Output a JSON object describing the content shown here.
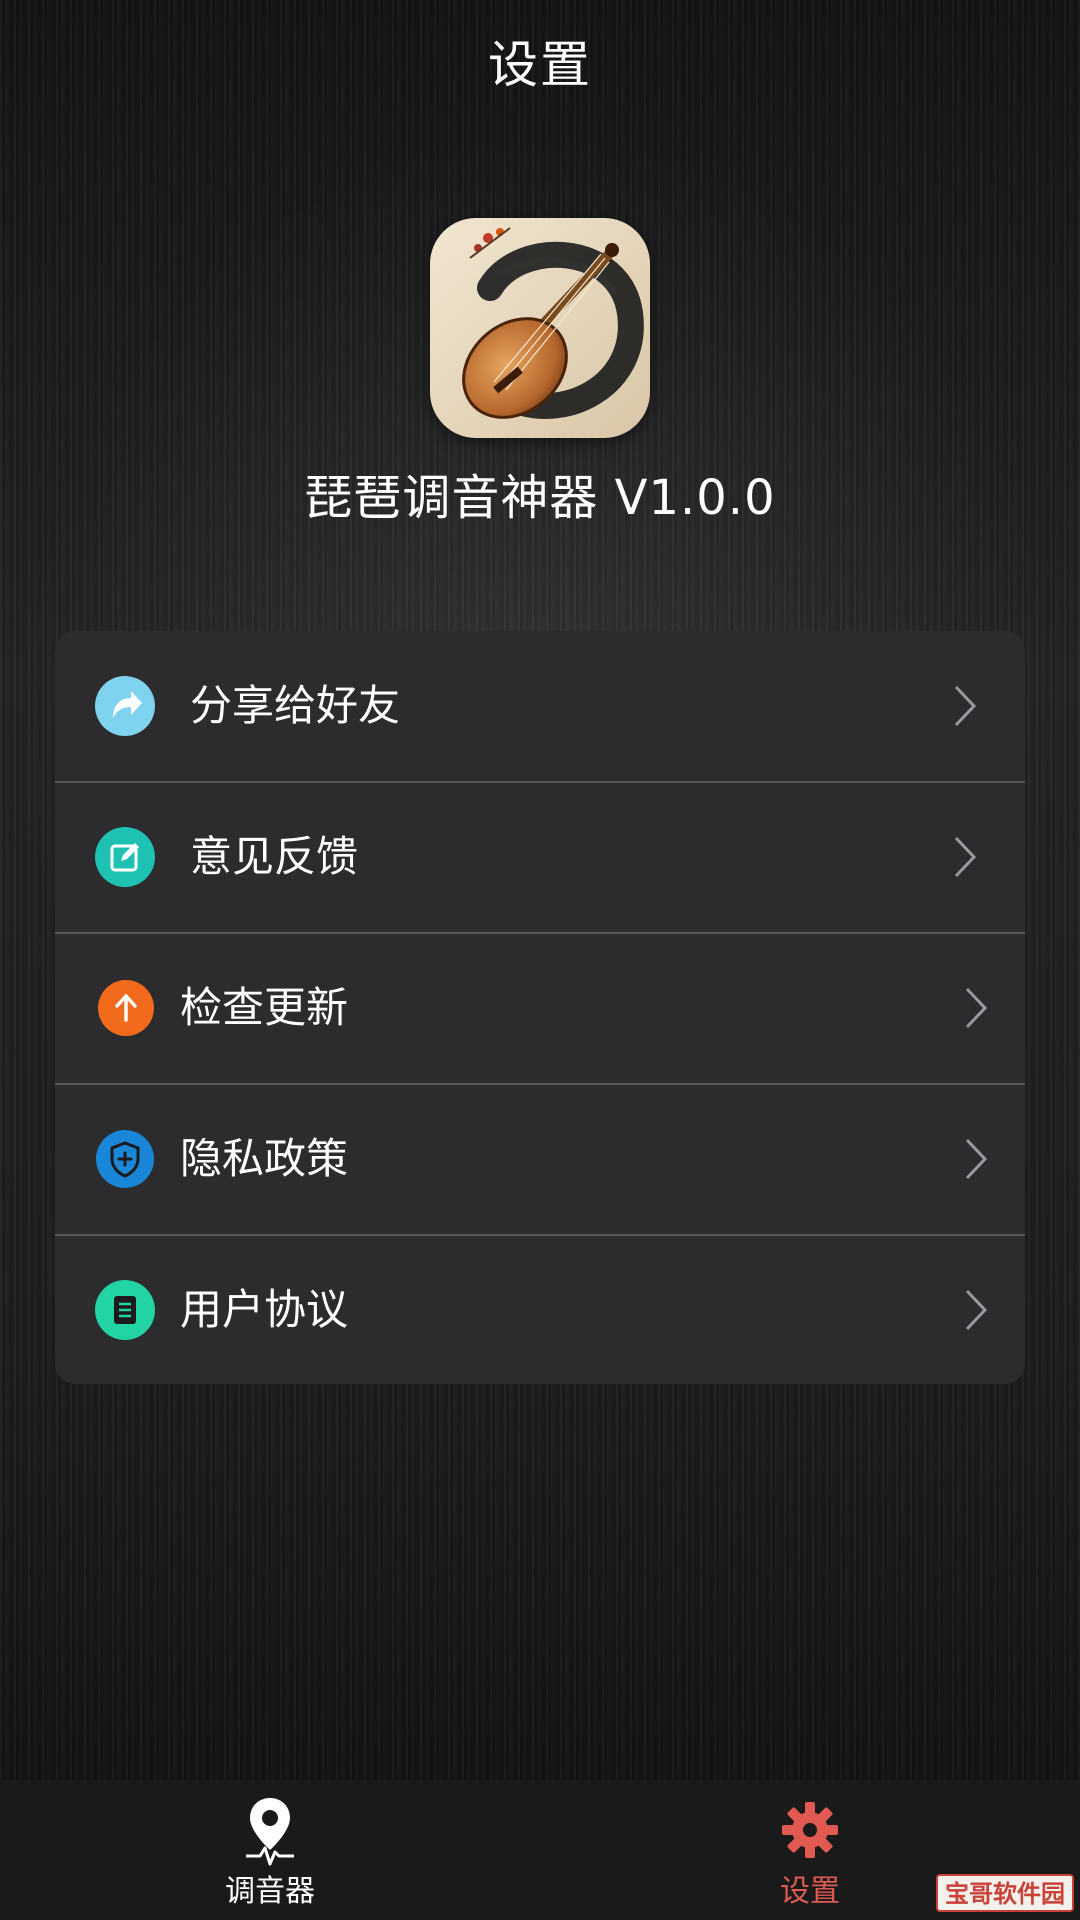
{
  "header": {
    "title": "设置"
  },
  "app": {
    "name_version": "琵琶调音神器 V1.0.0",
    "icon": "pipa-app-icon"
  },
  "menu": {
    "items": [
      {
        "label": "分享给好友",
        "icon": "share-icon",
        "icon_color": "#7fd3ee"
      },
      {
        "label": "意见反馈",
        "icon": "feedback-edit-icon",
        "icon_color": "#1fc1b3"
      },
      {
        "label": "检查更新",
        "icon": "update-arrow-up-icon",
        "icon_color": "#f26b1d"
      },
      {
        "label": "隐私政策",
        "icon": "privacy-shield-icon",
        "icon_color": "#1a86d8"
      },
      {
        "label": "用户协议",
        "icon": "agreement-document-icon",
        "icon_color": "#22d4a4"
      }
    ],
    "chevron_icon": "chevron-right-icon"
  },
  "tab_bar": {
    "tabs": [
      {
        "label": "调音器",
        "icon": "tuner-pin-icon",
        "active": false,
        "color": "#ffffff"
      },
      {
        "label": "设置",
        "icon": "gear-icon",
        "active": true,
        "color": "#e05a52"
      }
    ]
  },
  "watermark": {
    "text": "宝哥软件园"
  }
}
